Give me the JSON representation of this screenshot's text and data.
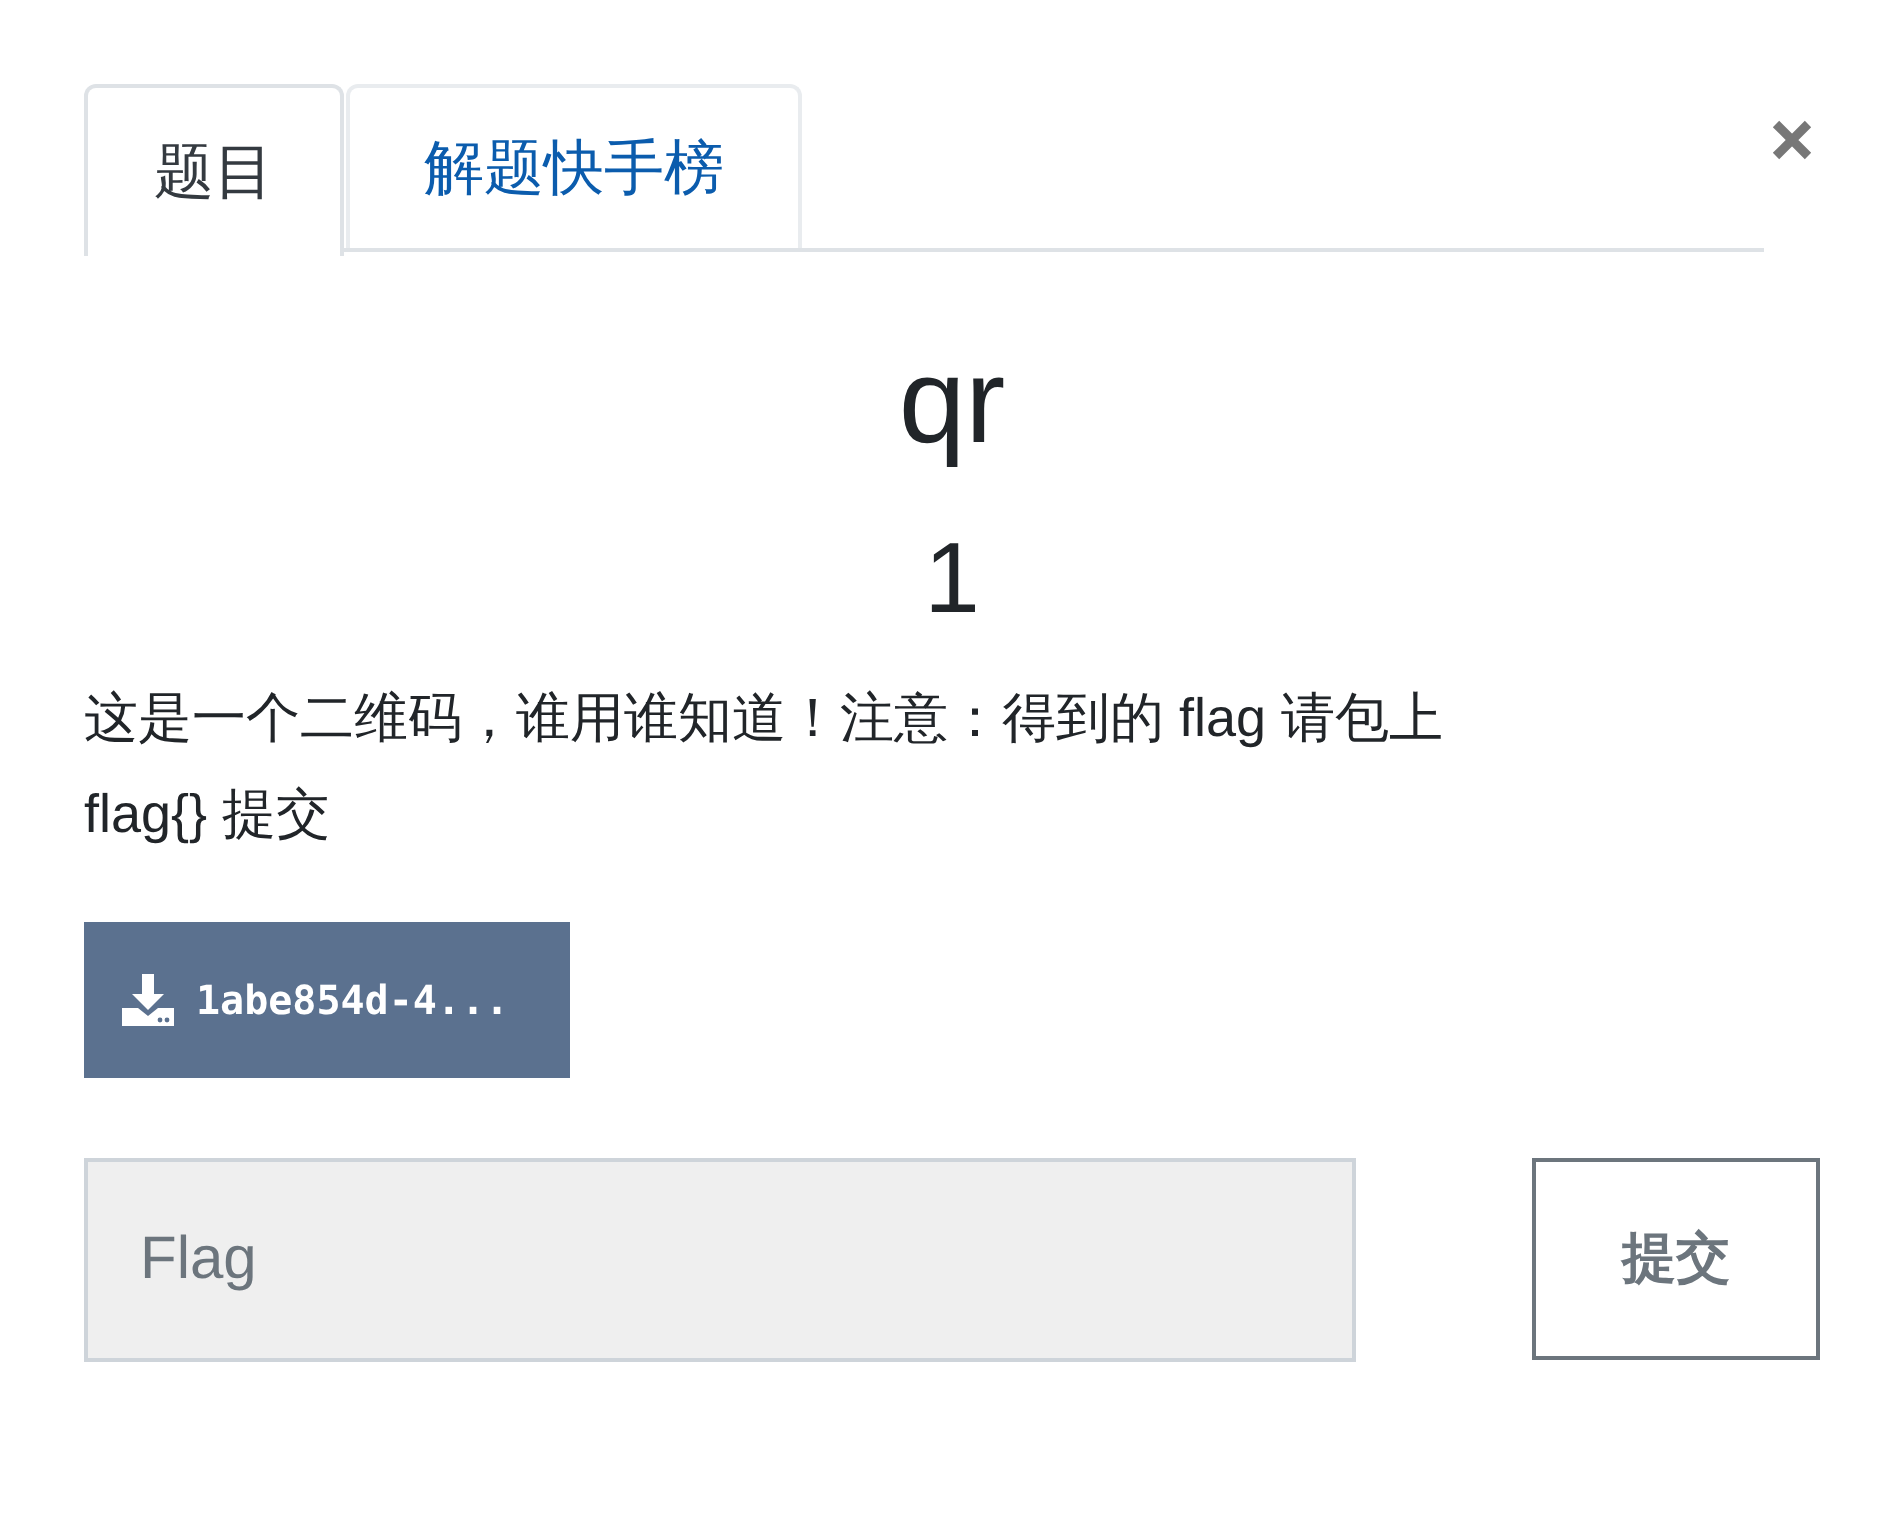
{
  "tabs": [
    {
      "label": "题目",
      "selected": true
    },
    {
      "label": "解题快手榜",
      "selected": false
    }
  ],
  "challenge": {
    "name": "qr",
    "value": "1",
    "description": "这是一个二维码，谁用谁知道！注意：得到的 flag 请包上 flag{} 提交"
  },
  "files": [
    {
      "label": "1abe854d-4..."
    }
  ],
  "flag_input": {
    "placeholder": "Flag"
  },
  "submit_button": {
    "label": "提交"
  }
}
